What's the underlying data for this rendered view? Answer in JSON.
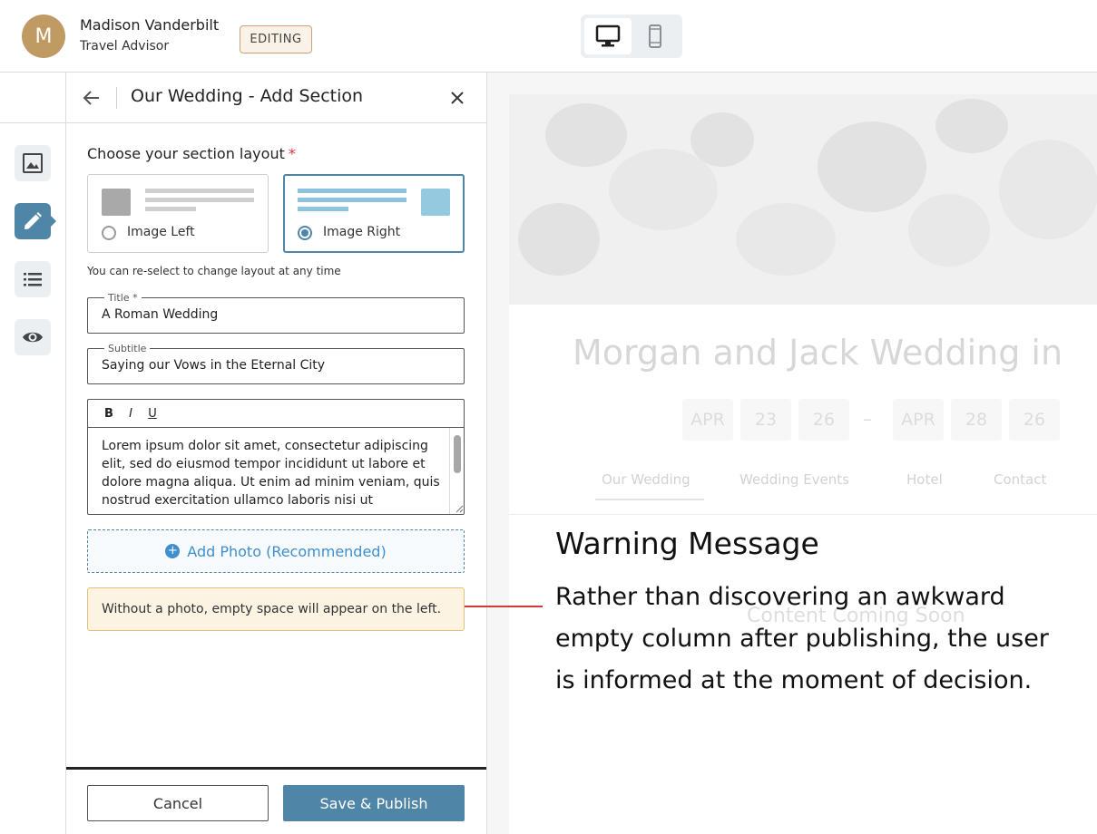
{
  "header": {
    "avatar_initial": "M",
    "user_name": "Madison Vanderbilt",
    "user_role": "Travel Advisor",
    "mode_badge": "EDITING",
    "device_modes": [
      "desktop",
      "mobile"
    ],
    "active_device": "desktop"
  },
  "rail": {
    "items": [
      {
        "icon": "image-icon",
        "active": false
      },
      {
        "icon": "pencil-icon",
        "active": true
      },
      {
        "icon": "list-icon",
        "active": false
      },
      {
        "icon": "eye-icon",
        "active": false
      }
    ]
  },
  "panel": {
    "title": "Our Wedding - Add Section",
    "layout_label": "Choose your section layout",
    "required_mark": "*",
    "layouts": [
      {
        "label": "Image Left",
        "selected": false
      },
      {
        "label": "Image Right",
        "selected": true
      }
    ],
    "layout_help": "You can re-select to change layout at any time",
    "title_field": {
      "label": "Title *",
      "value": "A Roman Wedding"
    },
    "subtitle_field": {
      "label": "Subtitle",
      "value": "Saying our Vows in the Eternal City"
    },
    "editor": {
      "toolbar": [
        "B",
        "I",
        "U"
      ],
      "body": "Lorem ipsum dolor sit amet, consectetur adipiscing elit, sed do eiusmod tempor incididunt ut labore et dolore magna aliqua. Ut enim ad minim veniam, quis nostrud exercitation ullamco laboris nisi ut"
    },
    "add_photo_label": "Add Photo (Recommended)",
    "warning_text": "Without a photo, empty space will appear on the left.",
    "cancel_label": "Cancel",
    "save_label": "Save & Publish"
  },
  "preview": {
    "title": "Morgan and Jack Wedding in",
    "date_start": [
      "APR",
      "23",
      "26"
    ],
    "date_separator": "–",
    "date_end": [
      "APR",
      "28",
      "26"
    ],
    "nav": [
      "Our Wedding",
      "Wedding Events",
      "Hotel",
      "Contact"
    ],
    "active_nav": "Our Wedding",
    "placeholder": "Content Coming Soon"
  },
  "annotation": {
    "title": "Warning Message",
    "body": "Rather than discovering an awkward empty column after publishing, the user is informed at the moment of decision.",
    "line_color": "#d43a3a"
  },
  "colors": {
    "accent": "#4f86a8",
    "link": "#3f8fd0",
    "warning_bg": "#fdf3e3",
    "warning_border": "#e7bf73",
    "avatar": "#c09a63"
  }
}
